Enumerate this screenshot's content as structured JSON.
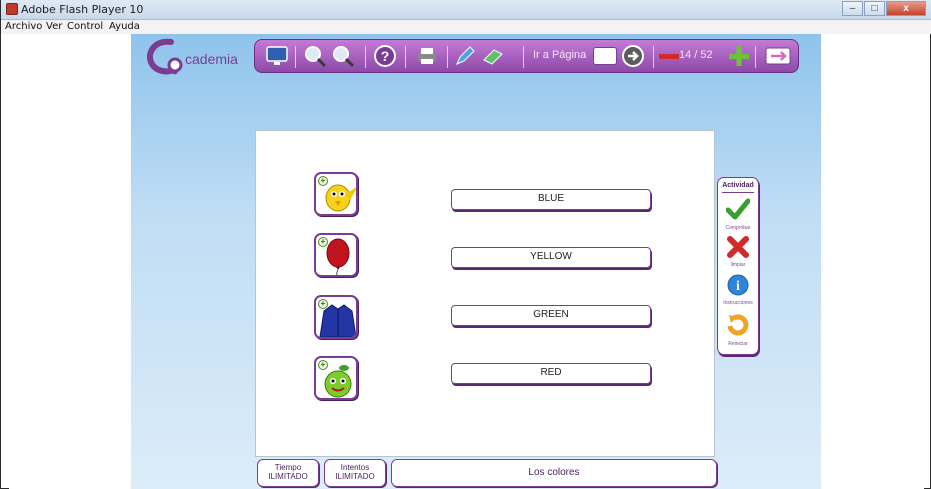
{
  "window": {
    "title": "Adobe Flash Player 10",
    "buttons": {
      "minimize": "–",
      "maximize": "□",
      "close": "x"
    }
  },
  "menu": {
    "items": [
      "Archivo",
      "Ver",
      "Control",
      "Ayuda"
    ]
  },
  "toolbar": {
    "logo_text": "cademia",
    "goto_label": "Ir a Página",
    "page_value": "",
    "counter": "14 / 52",
    "icons": [
      "monitor-icon",
      "zoom-in-icon",
      "zoom-out-icon",
      "help-icon",
      "print-icon",
      "pencil-icon",
      "eraser-icon",
      "go-arrow-icon",
      "minus-icon",
      "plus-icon",
      "exit-icon"
    ]
  },
  "exercise": {
    "images": [
      "chick-icon",
      "balloon-icon",
      "jacket-icon",
      "apple-icon"
    ],
    "words": [
      "BLUE",
      "YELLOW",
      "GREEN",
      "RED"
    ]
  },
  "activity": {
    "title": "Actividad",
    "items": [
      {
        "label": "Comprobar",
        "icon": "check-icon",
        "color": "#35a02b"
      },
      {
        "label": "limpiar",
        "icon": "x-icon",
        "color": "#d12a2a"
      },
      {
        "label": "Instrucciones",
        "icon": "info-icon",
        "color": "#2f86d8"
      },
      {
        "label": "Reiniciar",
        "icon": "restart-icon",
        "color": "#f0a325"
      }
    ]
  },
  "footer": {
    "time_label": "Tiempo",
    "time_value": "ILIMITADO",
    "tries_label": "Intentos",
    "tries_value": "ILIMITADO",
    "topic": "Los colores"
  },
  "colors": {
    "accent": "#8c4aa8",
    "stage_top": "#8fc3ec"
  }
}
